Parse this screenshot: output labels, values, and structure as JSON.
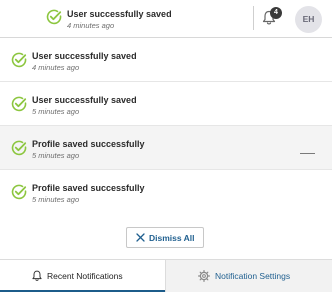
{
  "header": {
    "notification": {
      "title": "User successfully saved",
      "time": "4 minutes ago",
      "icon": "check-circle-icon"
    },
    "bell_icon": "bell-icon",
    "badge_count": "4",
    "avatar_initials": "EH"
  },
  "notifications": [
    {
      "title": "User successfully saved",
      "time": "4 minutes ago",
      "icon": "check-circle-icon"
    },
    {
      "title": "User successfully saved",
      "time": "5 minutes ago",
      "icon": "check-circle-icon"
    },
    {
      "title": "Profile saved successfully",
      "time": "5 minutes ago",
      "icon": "check-circle-icon"
    },
    {
      "title": "Profile saved successfully",
      "time": "5 minutes ago",
      "icon": "check-circle-icon"
    }
  ],
  "dismiss_all_label": "Dismiss All",
  "tabs": [
    {
      "label": "Recent Notifications",
      "icon": "bell-icon",
      "active": true
    },
    {
      "label": "Notification Settings",
      "icon": "gear-icon",
      "active": false
    }
  ],
  "colors": {
    "success_green": "#8cc63f",
    "link_blue": "#1f5f8f",
    "active_tab_underline": "#1c5c8a",
    "badge_bg": "#3a3a3a"
  }
}
